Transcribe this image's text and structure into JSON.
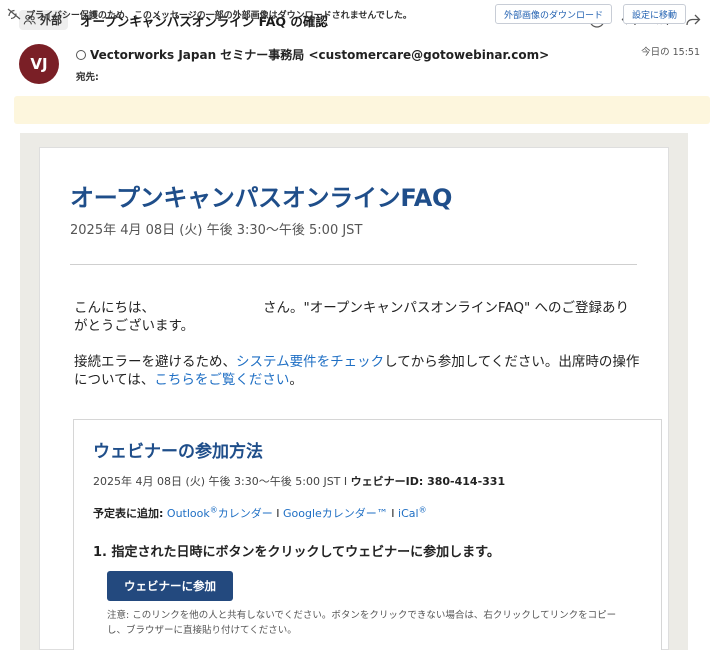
{
  "header": {
    "external_label": "外部",
    "subject": "オープンキャンパスオンライン FAQ の確認"
  },
  "sender": {
    "initials": "VJ",
    "name_line": "Vectorworks Japan セミナー事務局 <customercare@gotowebinar.com>",
    "to_label": "宛先:",
    "time": "今日の 15:51"
  },
  "banner": {
    "text": "プライバシー保護のため、このメッセージの一部の外部画像はダウンロードされませんでした。",
    "download_label": "外部画像のダウンロード",
    "settings_label": "設定に移動"
  },
  "email": {
    "title": "オープンキャンパスオンラインFAQ",
    "date": "2025年 4月 08日 (火) 午後 3:30～午後 5:00 JST",
    "greeting_start": "こんにちは、",
    "greeting_end": "さん。\"オープンキャンパスオンラインFAQ\" へのご登録ありがとうございます。",
    "p2_before": "接続エラーを避けるため、",
    "p2_link1": "システム要件をチェック",
    "p2_middle": "してから参加してください。出席時の操作については、",
    "p2_link2": "こちらをご覧ください",
    "p2_end": "。",
    "box": {
      "title": "ウェビナーの参加方法",
      "date_text": "2025年 4月 08日 (火) 午後 3:30～午後 5:00 JST I ",
      "webinar_id": "ウェビナーID: 380-414-331",
      "cal_label": "予定表に追加:",
      "outlook": "Outlook",
      "reg": "®",
      "outlook_cal": "カレンダー",
      "sep": " I ",
      "google": "Googleカレンダー™",
      "ical": "iCal",
      "step1": "1. 指定された日時にボタンをクリックしてウェビナーに参加します。",
      "join_label": "ウェビナーに参加",
      "note": "注意: このリンクを他の人と共有しないでください。ボタンをクリックできない場合は、右クリックしてリンクをコピーし、ブラウザーに直接貼り付けてください。"
    }
  },
  "colors": {
    "avatar_bg": "#7a1f26",
    "title": "#1f4e8a",
    "link": "#1f6fc4",
    "join_button": "#23497e",
    "banner_bg": "#fdf6dd"
  },
  "icons": [
    "external-people-icon",
    "emoji-icon",
    "reply-icon",
    "reply-all-icon",
    "forward-icon",
    "privacy-icon"
  ]
}
